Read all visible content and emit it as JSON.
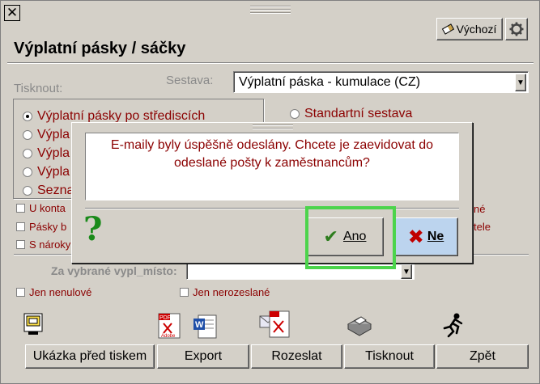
{
  "window": {
    "close_symbol": "✕",
    "title": "Výplatní pásky / sáčky"
  },
  "toolbar": {
    "default_label": "Výchozí",
    "eraser_icon": "eraser-icon",
    "settings_icon": "gear-icon"
  },
  "print_section": {
    "tisknout_label": "Tisknout:",
    "sestava_label": "Sestava:",
    "sestava_value": "Výplatní páska - kumulace (CZ)"
  },
  "radios_left": [
    {
      "label": "Výplatní pásky po střediscích",
      "checked": true
    },
    {
      "label": "Výpla",
      "checked": false
    },
    {
      "label": "Výpla",
      "checked": false
    },
    {
      "label": "Výpla",
      "checked": false
    },
    {
      "label": "Sezna",
      "checked": false
    }
  ],
  "radio_right": {
    "label": "Standartní sestava",
    "checked": false
  },
  "checks_left": [
    "U konta",
    "Pásky b",
    "S nároky"
  ],
  "checks_right_fragments": [
    "né",
    "tele"
  ],
  "za_label": "Za vybrané vypl_místo:",
  "za_value": "",
  "checks_bottom": [
    "Jen nenulové",
    "Jen nerozeslané"
  ],
  "bottom_buttons": {
    "preview": "Ukázka před tiskem",
    "export": "Export",
    "rozeslat": "Rozeslat",
    "tisknout": "Tisknout",
    "zpet": "Zpět"
  },
  "dialog": {
    "message_line1": "E-maily byly úspěšně odeslány. Chcete je zaevidovat do",
    "message_line2": "odeslané pošty k zaměstnancům?",
    "question_mark": "?",
    "yes_label": "Ano",
    "no_label": "Ne"
  },
  "colors": {
    "dark_red_text": "#8b0000",
    "highlight_green": "#4cd44c",
    "question_green": "#1a8a1a"
  }
}
